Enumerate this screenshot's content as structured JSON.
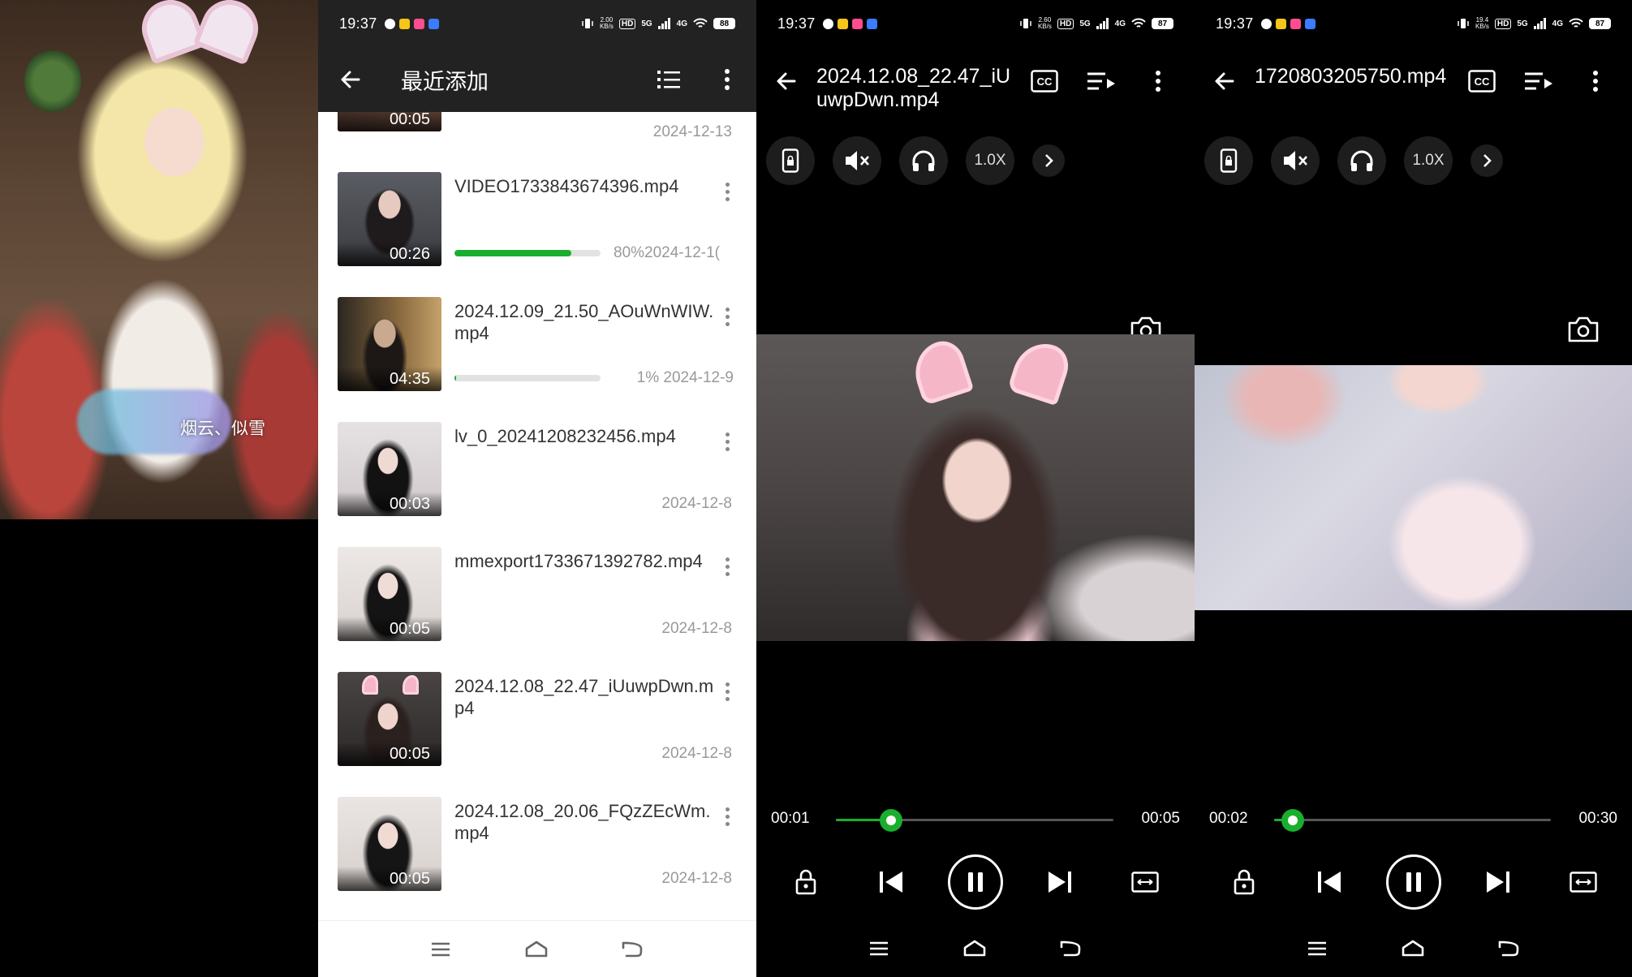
{
  "status": {
    "time": "19:37",
    "p2_speed_top": "2.00",
    "p2_speed_bottom": "KB/s",
    "p2_battery": "88",
    "p3_speed_top": "2.60",
    "p3_speed_bottom": "KB/s",
    "p3_battery": "87",
    "p4_speed_top": "19.4",
    "p4_speed_bottom": "KB/s",
    "p4_battery": "87",
    "hd": "HD",
    "net5g": "5G",
    "net4g": "4G"
  },
  "artwork": {
    "watermark": "烟云、似雪"
  },
  "list": {
    "title": "最近添加",
    "items": [
      {
        "duration": "00:05",
        "name": "",
        "date": "2024-12-13"
      },
      {
        "duration": "00:26",
        "name": "VIDEO1733843674396.mp4",
        "progress": 0.8,
        "progress_label": "80%",
        "date": "2024-12-1("
      },
      {
        "duration": "04:35",
        "name": "2024.12.09_21.50_AOuWnWIW.mp4",
        "progress": 0.01,
        "progress_label": "1%",
        "date": "2024-12-9"
      },
      {
        "duration": "00:03",
        "name": "lv_0_20241208232456.mp4",
        "date": "2024-12-8"
      },
      {
        "duration": "00:05",
        "name": "mmexport1733671392782.mp4",
        "date": "2024-12-8"
      },
      {
        "duration": "00:05",
        "name": "2024.12.08_22.47_iUuwpDwn.mp4",
        "date": "2024-12-8"
      },
      {
        "duration": "00:05",
        "name": "2024.12.08_20.06_FQzZEcWm.mp4",
        "date": "2024-12-8"
      }
    ]
  },
  "player1": {
    "title": "2024.12.08_22.47_iUuwpDwn.mp4",
    "speed": "1.0X",
    "current": "00:01",
    "total": "00:05",
    "progress": 0.2
  },
  "player2": {
    "title": "1720803205750.mp4",
    "speed": "1.0X",
    "current": "00:02",
    "total": "00:30",
    "progress": 0.067
  },
  "colors": {
    "accent": "#1aae2f",
    "toolbar": "#222222"
  }
}
